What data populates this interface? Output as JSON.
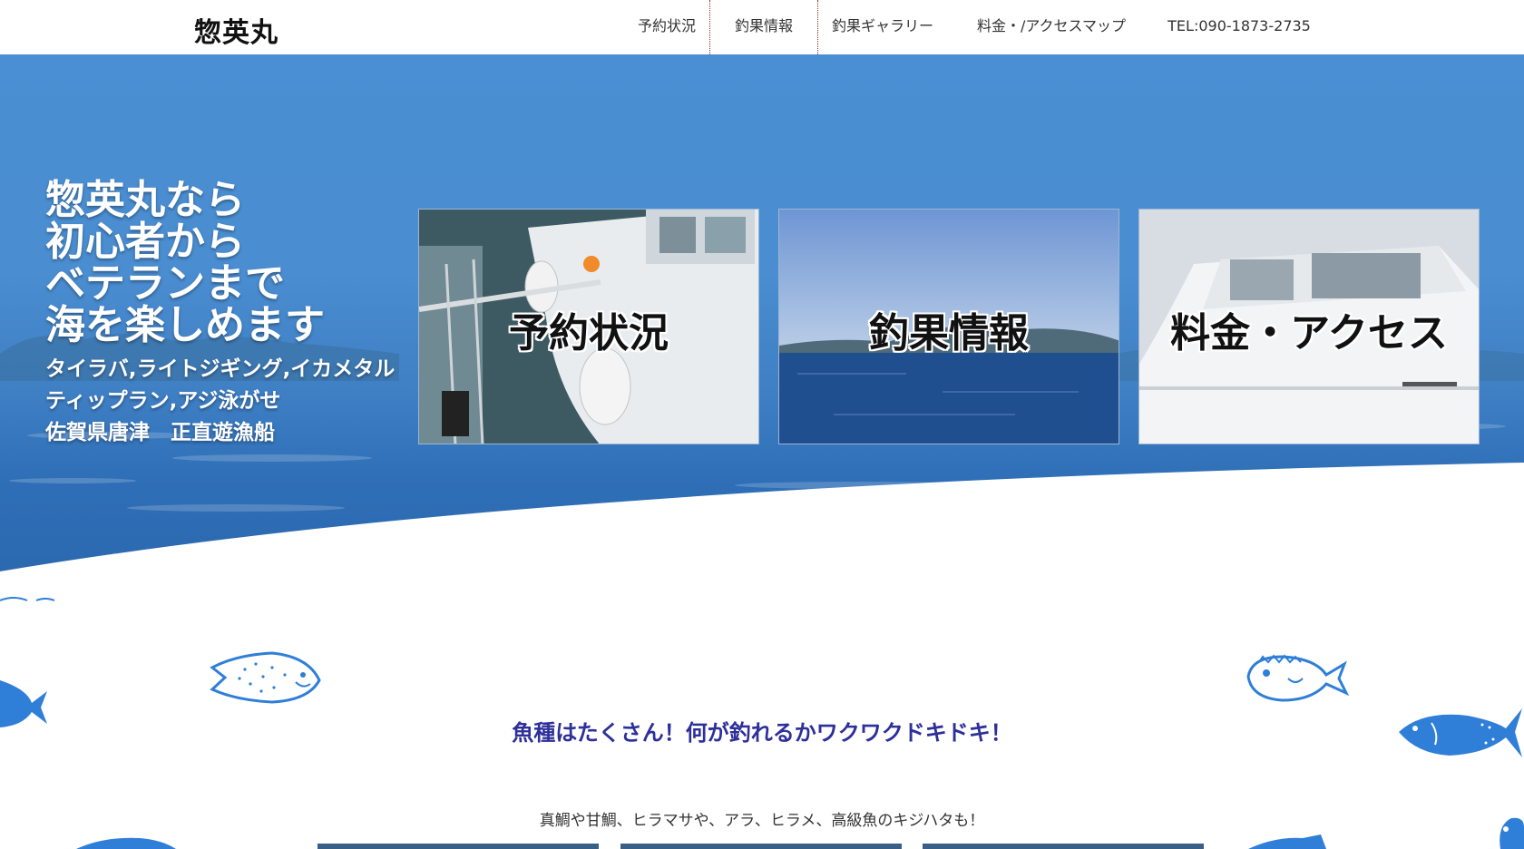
{
  "header": {
    "logo": "惣英丸",
    "nav": [
      {
        "label": "予約状況"
      },
      {
        "label": "釣果情報",
        "active": true
      },
      {
        "label": "釣果ギャラリー"
      },
      {
        "label": "料金・/アクセスマップ"
      },
      {
        "label": "TEL:090-1873-2735"
      }
    ]
  },
  "hero": {
    "lines": [
      "惣英丸なら",
      "初心者から",
      "ベテランまで",
      "海を楽しめます"
    ],
    "sublines": [
      "タイラバ,ライトジギング,イカメタル",
      "ティップラン,アジ泳がせ",
      "佐賀県唐津　正直遊漁船"
    ],
    "cards": [
      {
        "label": "予約状況"
      },
      {
        "label": "釣果情報"
      },
      {
        "label": "料金・アクセス"
      }
    ]
  },
  "section": {
    "headline": "魚種はたくさん！何が釣れるかワクワクドキドキ！",
    "subline": "真鯛や甘鯛、ヒラマサや、アラ、ヒラメ、高級魚のキジハタも！"
  },
  "colors": {
    "sea": "#4a8fd3",
    "headline": "#2d2f9a",
    "fish": "#2f7fd8"
  }
}
